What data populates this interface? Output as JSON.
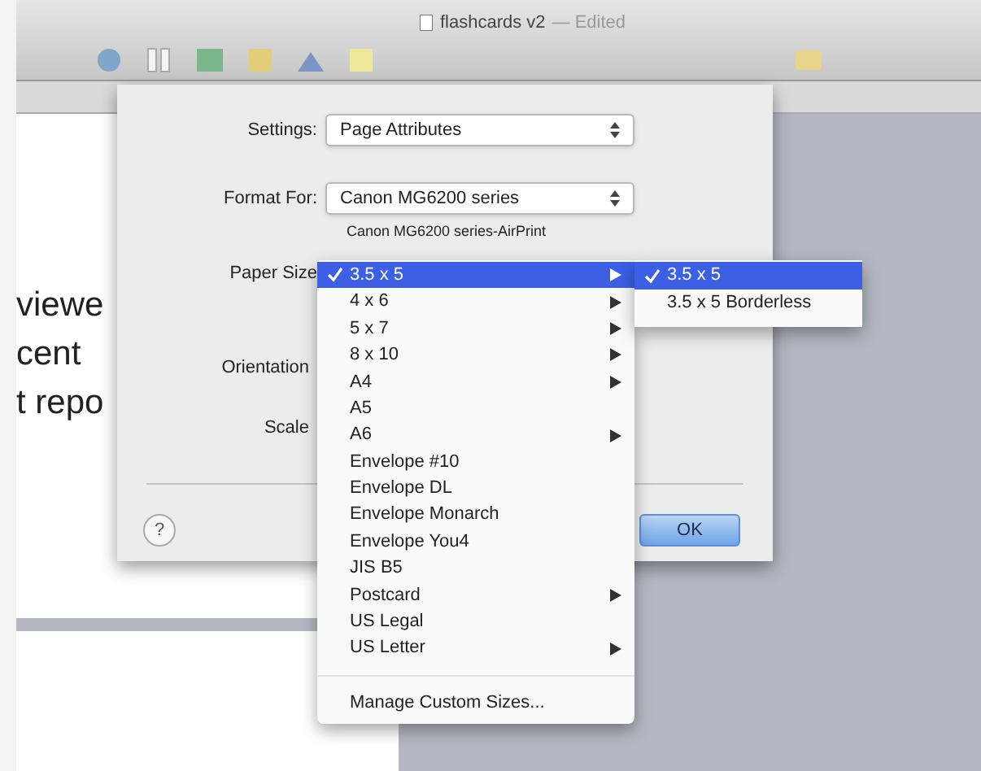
{
  "window": {
    "title": "flashcards v2",
    "status": "— Edited"
  },
  "document": {
    "lines": [
      "viewe",
      "cent",
      "t repo"
    ]
  },
  "dialog": {
    "settings": {
      "label": "Settings:",
      "value": "Page Attributes"
    },
    "format_for": {
      "label": "Format For:",
      "value": "Canon MG6200 series",
      "detail": "Canon MG6200 series-AirPrint"
    },
    "paper_size": {
      "label": "Paper Size"
    },
    "orientation": {
      "label": "Orientation"
    },
    "scale": {
      "label": "Scale"
    },
    "buttons": [
      {
        "kind": "help",
        "label": "?"
      },
      {
        "kind": "default",
        "label": "OK"
      }
    ]
  },
  "menu": {
    "items": [
      {
        "label": "3.5 x 5",
        "selected": true,
        "submenu": true
      },
      {
        "label": "4 x 6",
        "selected": false,
        "submenu": true
      },
      {
        "label": "5 x 7",
        "selected": false,
        "submenu": true
      },
      {
        "label": "8 x 10",
        "selected": false,
        "submenu": true
      },
      {
        "label": "A4",
        "selected": false,
        "submenu": true
      },
      {
        "label": "A5",
        "selected": false,
        "submenu": false
      },
      {
        "label": "A6",
        "selected": false,
        "submenu": true
      },
      {
        "label": "Envelope #10",
        "selected": false,
        "submenu": false
      },
      {
        "label": "Envelope DL",
        "selected": false,
        "submenu": false
      },
      {
        "label": "Envelope Monarch",
        "selected": false,
        "submenu": false
      },
      {
        "label": "Envelope You4",
        "selected": false,
        "submenu": false
      },
      {
        "label": "JIS B5",
        "selected": false,
        "submenu": false
      },
      {
        "label": "Postcard",
        "selected": false,
        "submenu": true
      },
      {
        "label": "US Legal",
        "selected": false,
        "submenu": false
      },
      {
        "label": "US Letter",
        "selected": false,
        "submenu": true
      }
    ],
    "footer": "Manage Custom Sizes..."
  },
  "submenu": {
    "items": [
      {
        "label": "3.5 x 5",
        "selected": true
      },
      {
        "label": "3.5 x 5 Borderless",
        "selected": false
      }
    ]
  }
}
